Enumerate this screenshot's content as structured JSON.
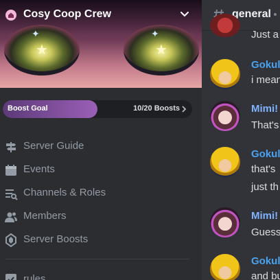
{
  "server": {
    "name": "Cosy Coop Crew",
    "icon": "home-icon",
    "banner": "anime-eyes-artwork"
  },
  "boost": {
    "label": "Boost Goal",
    "count": "10/20 Boosts",
    "progress": 0.5,
    "color": "#9b5fb7"
  },
  "nav": [
    {
      "label": "Server Guide",
      "icon": "signpost-icon"
    },
    {
      "label": "Events",
      "icon": "calendar-icon"
    },
    {
      "label": "Channels & Roles",
      "icon": "channel-browse-icon"
    },
    {
      "label": "Members",
      "icon": "members-icon"
    },
    {
      "label": "Server Boosts",
      "icon": "boost-gem-icon"
    }
  ],
  "channel_partial": {
    "label": "rules",
    "icon": "rules-checkbox-icon"
  },
  "channel": {
    "name": "general",
    "icon": "hash-icon"
  },
  "messages": [
    {
      "author": "",
      "text": "Just a"
    },
    {
      "author": "Gokulv",
      "text": "i mean"
    },
    {
      "author": "Mimi!",
      "text": "That's"
    },
    {
      "author": "Gokulv",
      "text": "that's",
      "text2": "just th"
    },
    {
      "author": "Mimi!",
      "text": "Guess"
    },
    {
      "author": "Gokulv",
      "text": "and bu"
    }
  ],
  "colors": {
    "sidebar": "#2b2d31",
    "chat": "#313338",
    "muted_text": "#949ba4",
    "author_blue": "#4aa3f0"
  }
}
